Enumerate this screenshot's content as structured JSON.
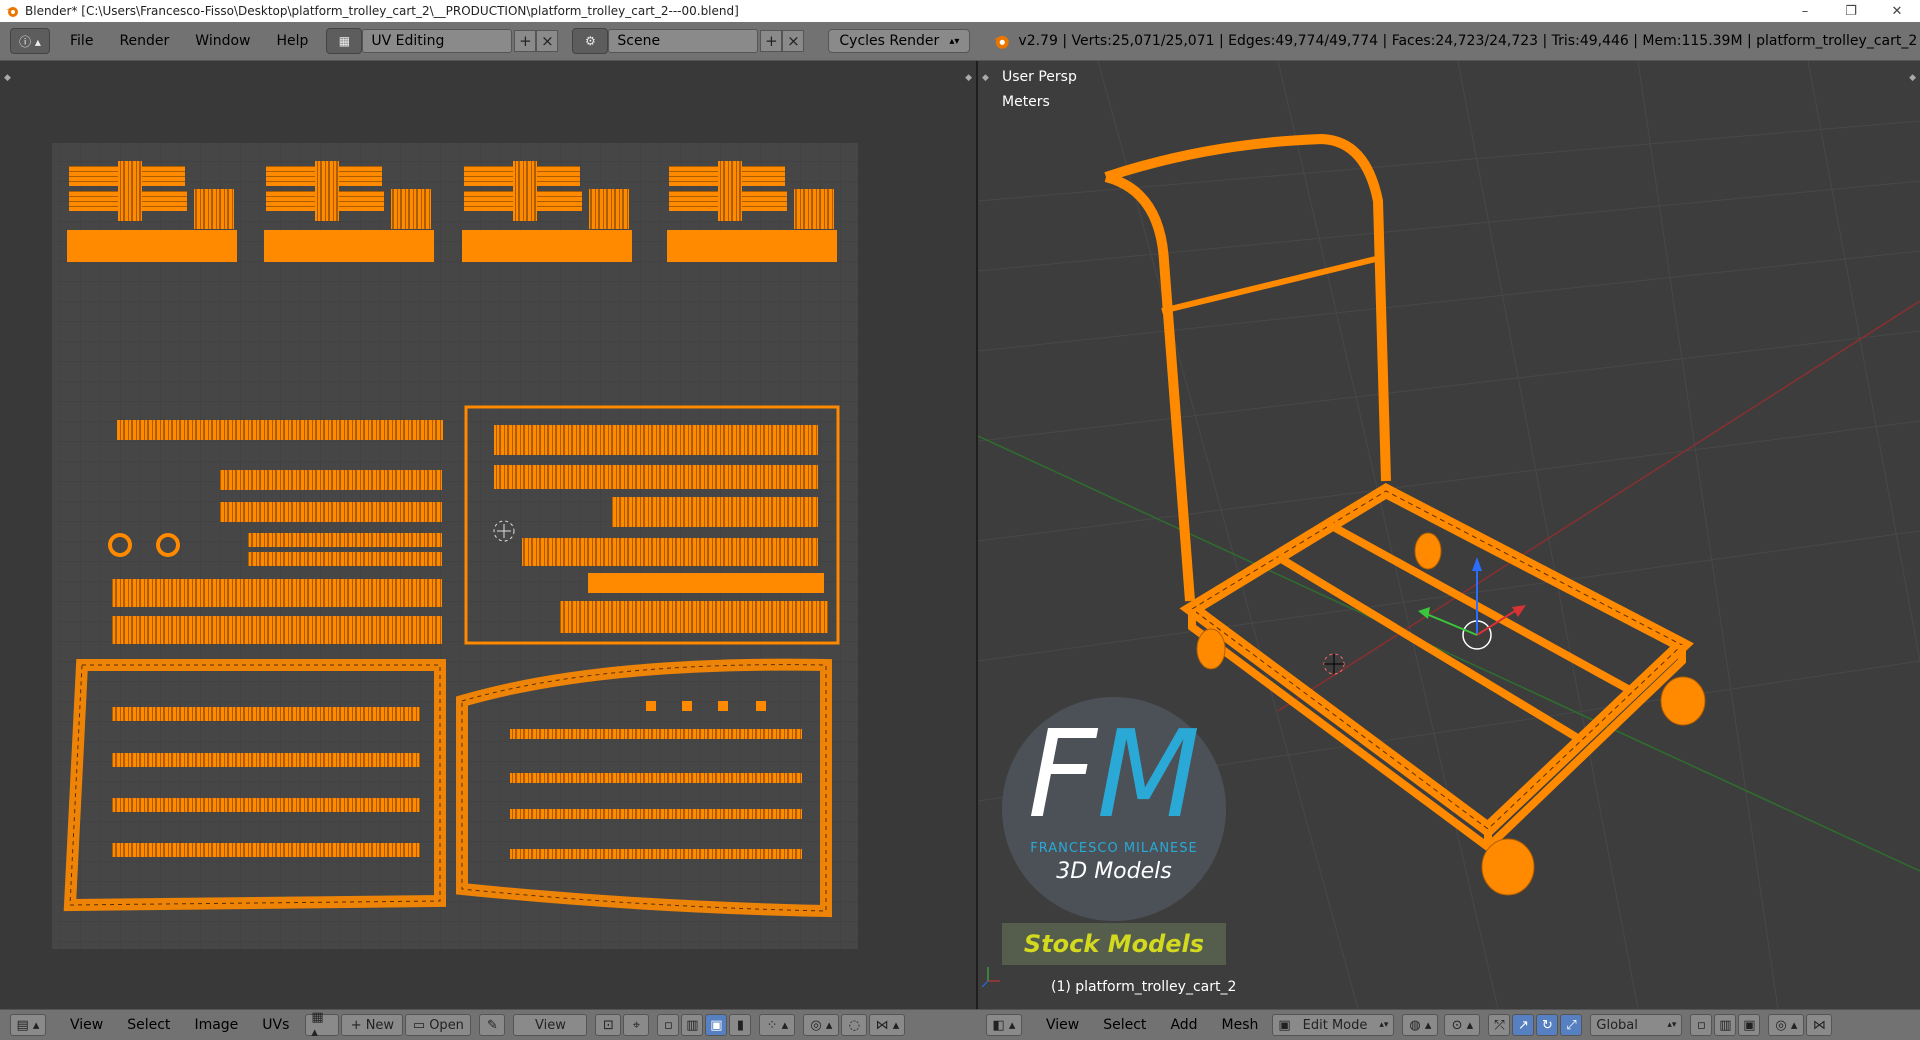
{
  "window": {
    "title": "Blender* [C:\\Users\\Francesco-Fisso\\Desktop\\platform_trolley_cart_2\\__PRODUCTION\\platform_trolley_cart_2---00.blend]",
    "controls": {
      "minimize": "–",
      "maximize": "❐",
      "close": "✕"
    }
  },
  "header": {
    "menus": [
      "File",
      "Render",
      "Window",
      "Help"
    ],
    "layout": "UV Editing",
    "scene": "Scene",
    "engine": "Cycles Render",
    "stats": "v2.79 | Verts:25,071/25,071 | Edges:49,774/49,774 | Faces:24,723/24,723 | Tris:49,446 | Mem:115.39M | platform_trolley_cart_2"
  },
  "viewport": {
    "persp_label": "User Persp",
    "units_label": "Meters",
    "object_label": "(1) platform_trolley_cart_2",
    "watermark": {
      "initials_f": "F",
      "initials_m": "M",
      "name": "FRANCESCO MILANESE",
      "subtitle": "3D Models",
      "badge": "Stock Models"
    }
  },
  "uv_footer": {
    "menus": [
      "View",
      "Select",
      "Image",
      "UVs"
    ],
    "new_label": "New",
    "open_label": "Open",
    "view_label": "View"
  },
  "view3d_footer": {
    "menus": [
      "View",
      "Select",
      "Add",
      "Mesh"
    ],
    "mode": "Edit Mode",
    "orientation": "Global"
  },
  "colors": {
    "uv_orange": "#ff8a00",
    "panel_bg": "#393939",
    "header_bg": "#727272",
    "axis_red": "#c83232",
    "axis_green": "#2e8b2e"
  }
}
